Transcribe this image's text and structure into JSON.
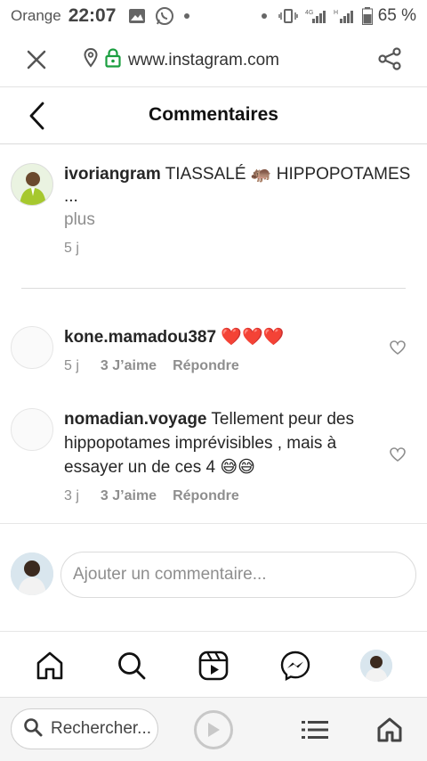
{
  "status_bar": {
    "carrier": "Orange",
    "time": "22:07",
    "network": "4G",
    "signal_h": "H",
    "battery": "65 %",
    "icons": [
      "image-icon",
      "whatsapp-icon",
      "dot-icon",
      "dot-icon",
      "vibrate-icon",
      "signal-4g-icon",
      "signal-h-icon",
      "battery-icon"
    ]
  },
  "browser": {
    "url": "www.instagram.com",
    "icons": [
      "close-icon",
      "location-pin-icon",
      "lock-icon",
      "share-icon"
    ],
    "lock_color": "#1a9e3f"
  },
  "header": {
    "title": "Commentaires"
  },
  "caption": {
    "username": "ivoriangram",
    "text": " TIASSALÉ 🐛 HIPPOPOTAMES ...",
    "text_emoji": "🦛",
    "more_label": "plus",
    "time": "5 j"
  },
  "comments": [
    {
      "username": "kone.mamadou387",
      "text": " ❤️❤️❤️",
      "time": "5 j",
      "likes": "3 J’aime",
      "reply_label": "Répondre"
    },
    {
      "username": "nomadian.voyage",
      "text": " Tellement peur des hippopotames imprévisibles , mais à essayer un de ces 4 😅😅",
      "time": "3 j",
      "likes": "3 J’aime",
      "reply_label": "Répondre"
    }
  ],
  "add_comment": {
    "placeholder": "Ajouter un commentaire..."
  },
  "nav": {
    "items": [
      "home-icon",
      "search-icon",
      "reels-icon",
      "messenger-icon",
      "profile-avatar"
    ]
  },
  "browser_bottom": {
    "search_label": "Rechercher...",
    "icons": [
      "search-icon",
      "play-icon",
      "list-icon",
      "home-icon"
    ]
  },
  "colors": {
    "text": "#262626",
    "secondary": "#8e8e8e",
    "divider": "#dbdbdb",
    "heart": "#e0245e"
  }
}
